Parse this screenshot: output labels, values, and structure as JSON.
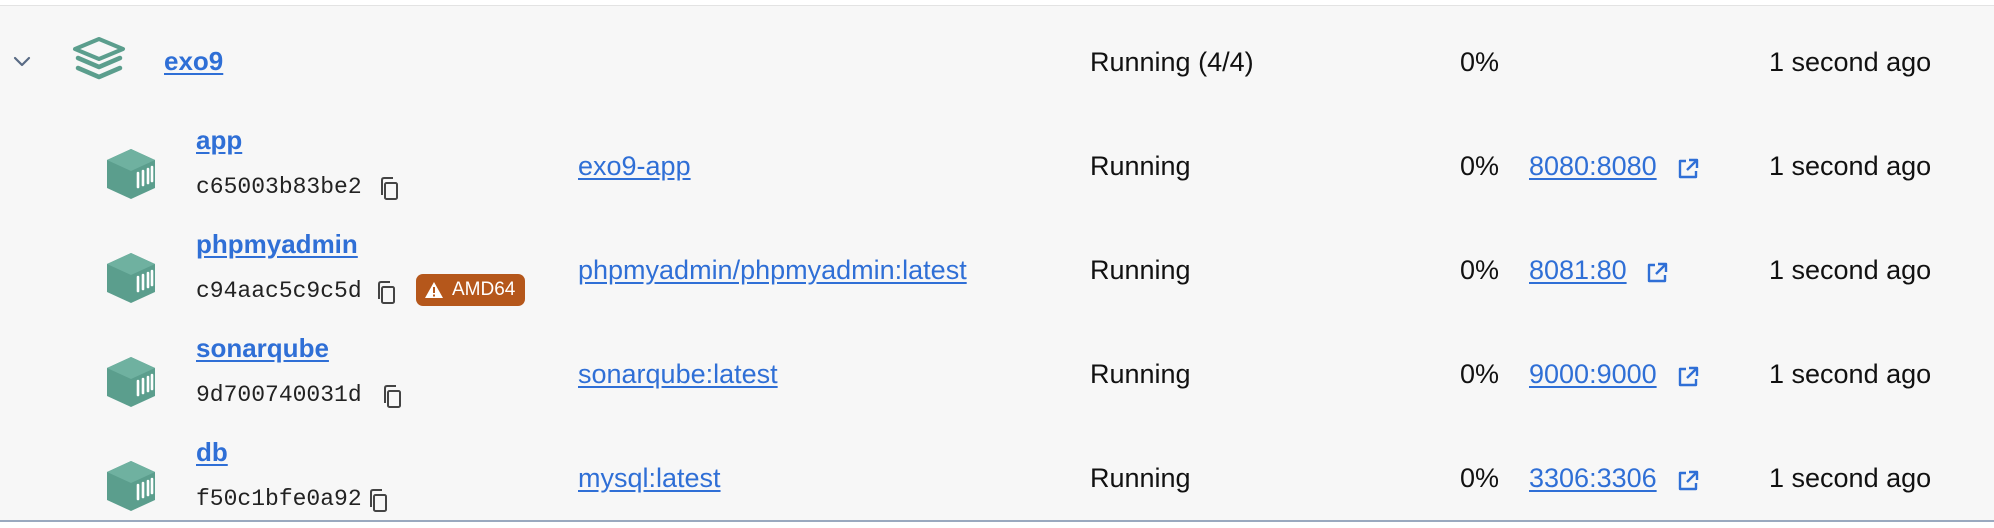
{
  "colors": {
    "accent": "#2f6fd6",
    "icon_green": "#5b9e8d",
    "warning_badge": "#b5571b",
    "panel_bg": "#f7f7f7"
  },
  "group": {
    "name": "exo9",
    "status": "Running (4/4)",
    "cpu": "0%",
    "last_started": "1 second ago",
    "icon": "stack-layers-icon",
    "expand_icon": "chevron-down-icon"
  },
  "containers": [
    {
      "name": "app",
      "id": "c65003b83be2",
      "image": "exo9-app",
      "status": "Running",
      "cpu": "0%",
      "port": "8080:8080",
      "last_started": "1 second ago",
      "badge": ""
    },
    {
      "name": "phpmyadmin",
      "id": "c94aac5c9c5d",
      "image": "phpmyadmin/phpmyadmin:latest",
      "status": "Running",
      "cpu": "0%",
      "port": "8081:80",
      "last_started": "1 second ago",
      "badge": "AMD64"
    },
    {
      "name": "sonarqube",
      "id": "9d700740031d",
      "image": "sonarqube:latest",
      "status": "Running",
      "cpu": "0%",
      "port": "9000:9000",
      "last_started": "1 second ago",
      "badge": ""
    },
    {
      "name": "db",
      "id": "f50c1bfe0a92",
      "image": "mysql:latest",
      "status": "Running",
      "cpu": "0%",
      "port": "3306:3306",
      "last_started": "1 second ago",
      "badge": ""
    }
  ]
}
